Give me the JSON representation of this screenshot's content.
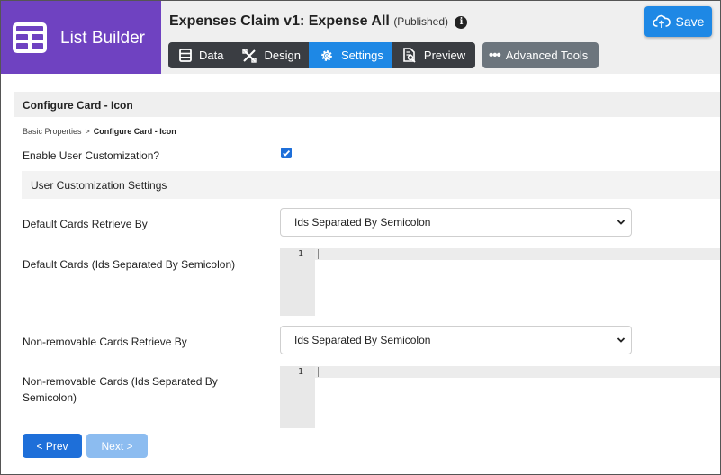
{
  "brand": {
    "title": "List Builder"
  },
  "app": {
    "title": "Expenses Claim v1: Expense All",
    "status": "(Published)"
  },
  "tabs": [
    {
      "label": "Data",
      "icon": "data-icon"
    },
    {
      "label": "Design",
      "icon": "design-icon"
    },
    {
      "label": "Settings",
      "icon": "gear-icon"
    },
    {
      "label": "Preview",
      "icon": "preview-icon"
    }
  ],
  "active_tab": "Settings",
  "advanced_tools": {
    "label": "Advanced Tools"
  },
  "save": {
    "label": "Save"
  },
  "section": {
    "title": "Configure Card - Icon"
  },
  "breadcrumb": {
    "parent": "Basic Properties",
    "separator": ">",
    "current": "Configure Card - Icon"
  },
  "form": {
    "enable_customization": {
      "label": "Enable User Customization?",
      "checked": true
    },
    "customization_settings": {
      "title": "User Customization Settings"
    },
    "default_retrieve_by": {
      "label": "Default Cards Retrieve By",
      "value": "Ids Separated By Semicolon"
    },
    "default_cards": {
      "label": "Default Cards (Ids Separated By Semicolon)",
      "line_number": "1",
      "value": ""
    },
    "nonremovable_retrieve_by": {
      "label": "Non-removable Cards Retrieve By",
      "value": "Ids Separated By Semicolon"
    },
    "nonremovable_cards": {
      "label_line1": "Non-removable Cards (Ids Separated By",
      "label_line2": "Semicolon)",
      "line_number": "1",
      "value": ""
    }
  },
  "nav": {
    "prev_label": "< Prev",
    "next_label": "Next >"
  },
  "colors": {
    "brand": "#6f42c1",
    "accent": "#1e88e5",
    "primary_button": "#1e6fd9",
    "disabled_button": "#8cbcf0"
  }
}
